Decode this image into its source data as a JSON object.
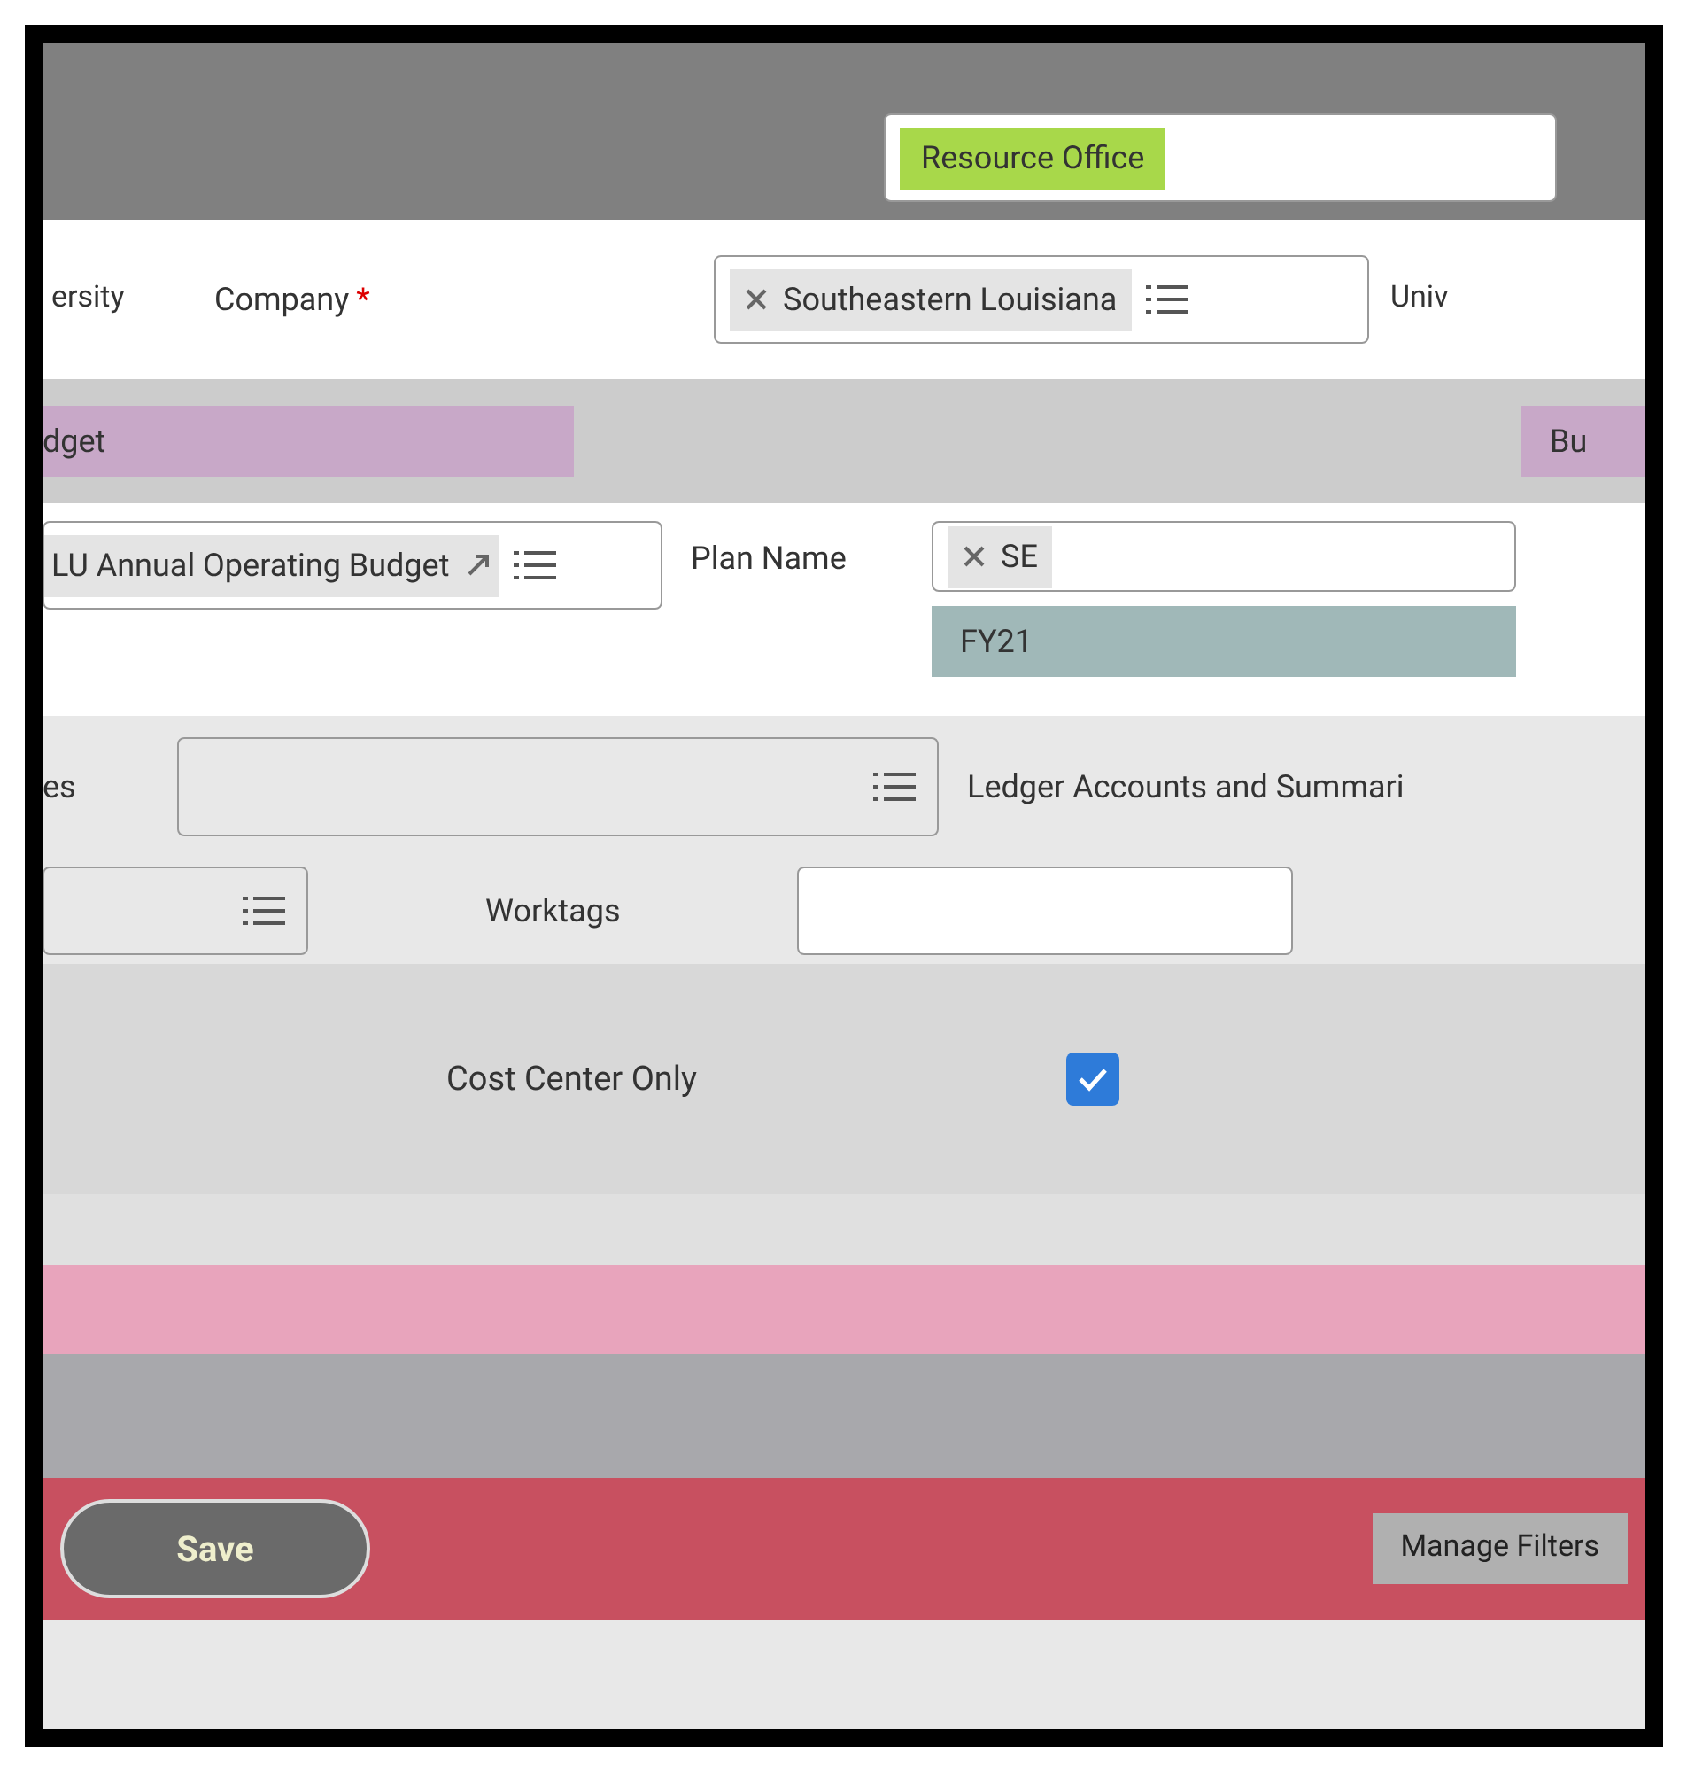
{
  "owner_field": {
    "chip": "Resource Office"
  },
  "company": {
    "label": "Company",
    "required_mark": "*",
    "chip": "Southeastern Louisiana",
    "left_text": "ersity",
    "right_text": "Univ"
  },
  "budget_row": {
    "left_text": "dget",
    "right_text": "Bu"
  },
  "plan": {
    "budget_chip": "LU Annual Operating Budget",
    "label": "Plan Name",
    "right_chip": "SE",
    "value": "FY21"
  },
  "ledger": {
    "left_text": "es",
    "label": "Ledger Accounts and Summari"
  },
  "worktags": {
    "label": "Worktags"
  },
  "checkboxes": [
    {
      "label": "Cost Center Only",
      "checked": true
    }
  ],
  "buttons": {
    "save": "Save",
    "filters": "Manage Filters"
  }
}
